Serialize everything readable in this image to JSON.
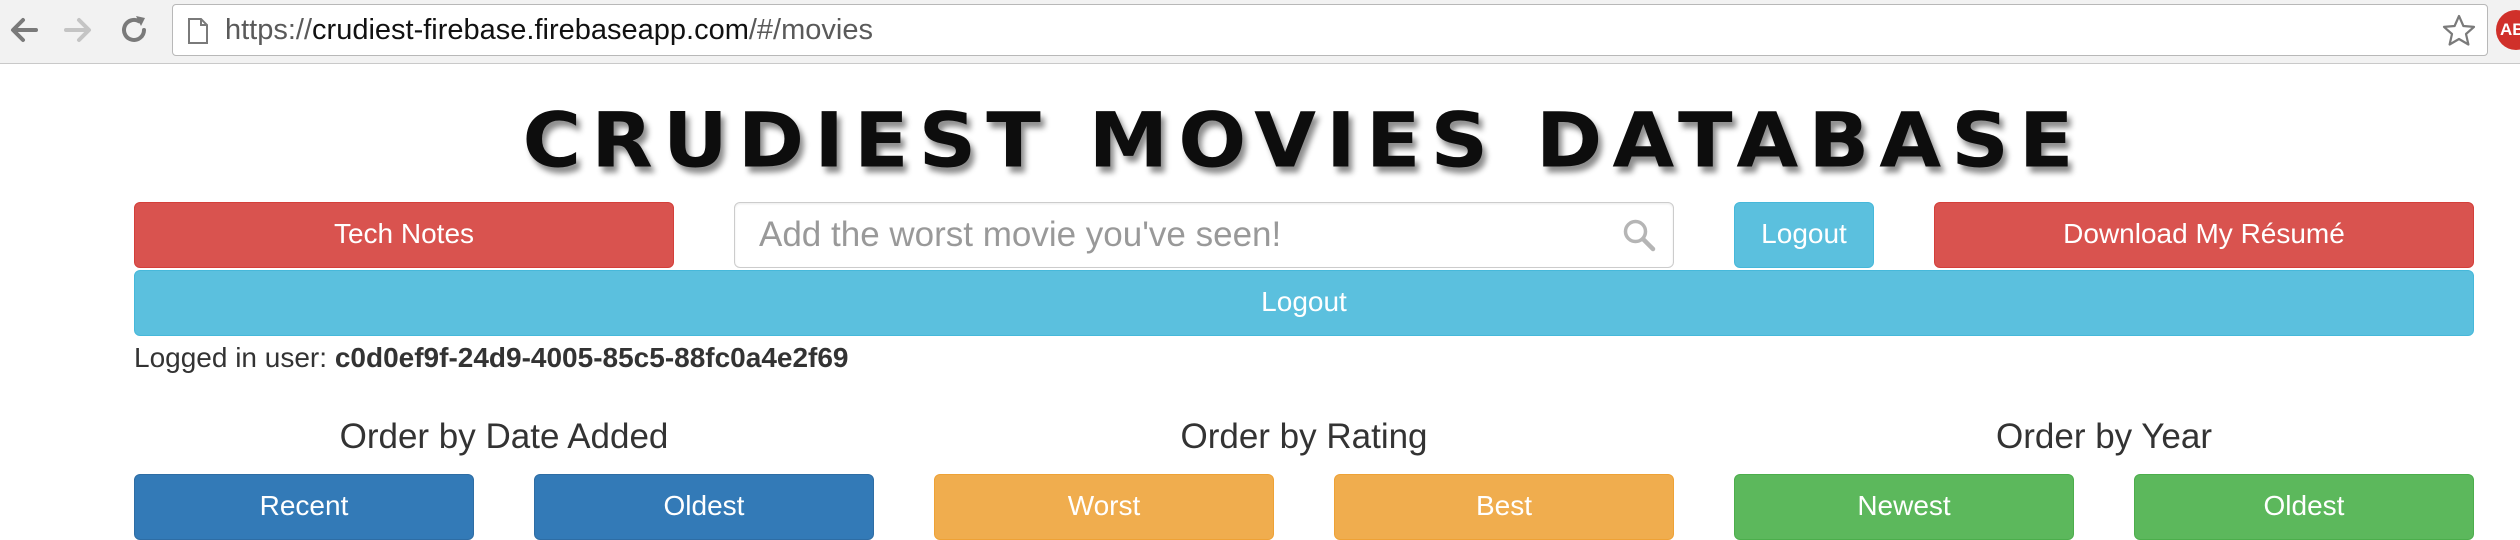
{
  "browser": {
    "url_scheme": "https://",
    "url_host": "crudiest-firebase.firebaseapp.com",
    "url_path": "/#/movies",
    "extension_badge": "AB"
  },
  "site": {
    "title": "CRUDIEST MOVIES DATABASE"
  },
  "toolbar": {
    "tech_notes_label": "Tech Notes",
    "search_placeholder": "Add the worst movie you've seen!",
    "logout_small_label": "Logout",
    "resume_label": "Download My Résumé",
    "logout_wide_label": "Logout"
  },
  "user": {
    "prefix": "Logged in user:",
    "id": "c0d0ef9f-24d9-4005-85c5-88fc0a4e2f69"
  },
  "ordering": {
    "date_added": {
      "heading": "Order by Date Added",
      "first": "Recent",
      "second": "Oldest"
    },
    "rating": {
      "heading": "Order by Rating",
      "first": "Worst",
      "second": "Best"
    },
    "year": {
      "heading": "Order by Year",
      "first": "Newest",
      "second": "Oldest"
    }
  },
  "colors": {
    "danger": "#d9534f",
    "info": "#5bc0de",
    "primary": "#337ab7",
    "warning": "#f0ad4e",
    "success": "#5cb85c"
  },
  "icons": {
    "back": "back-arrow-icon",
    "forward": "forward-arrow-icon",
    "reload": "reload-icon",
    "page": "page-icon",
    "bookmark": "star-icon",
    "search": "search-icon",
    "adblock": "adblock-icon"
  }
}
